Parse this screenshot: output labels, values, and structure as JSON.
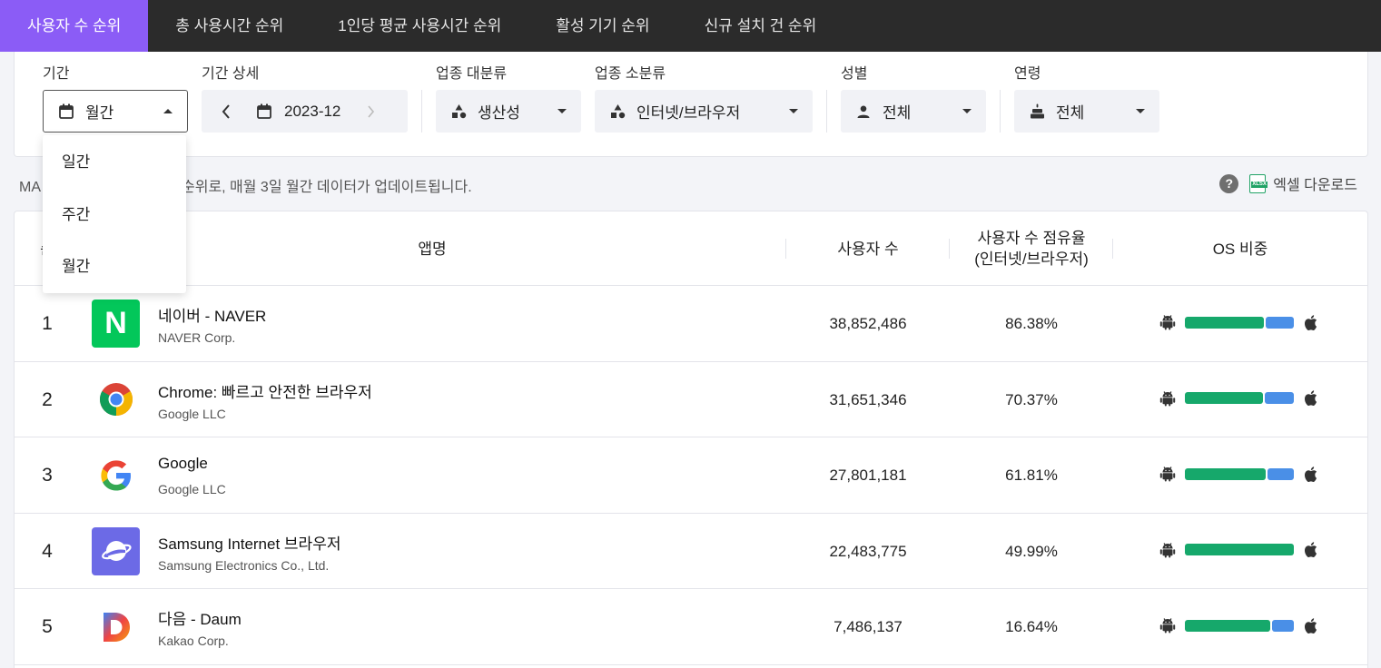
{
  "tabs": [
    "사용자 수 순위",
    "총 사용시간 순위",
    "1인당 평균 사용시간 순위",
    "활성 기기 순위",
    "신규 설치 건 순위"
  ],
  "filters": {
    "period_label": "기간",
    "period_value": "월간",
    "period_detail_label": "기간 상세",
    "period_detail_value": "2023-12",
    "major_category_label": "업종 대분류",
    "major_category_value": "생산성",
    "minor_category_label": "업종 소분류",
    "minor_category_value": "인터넷/브라우저",
    "gender_label": "성별",
    "gender_value": "전체",
    "age_label": "연령",
    "age_value": "전체"
  },
  "period_dropdown": [
    "일간",
    "주간",
    "월간"
  ],
  "info_prefix": "MA",
  "info_text": "ers) 순위로, 매월 3일 월간 데이터가 업데이트됩니다.",
  "excel_download": "엑셀 다운로드",
  "excel_badge": "XLSX",
  "table": {
    "headers": {
      "rank": "순",
      "app": "앱명",
      "users": "사용자 수",
      "share_line1": "사용자 수 점유율",
      "share_line2": "(인터넷/브라우저)",
      "os": "OS 비중"
    },
    "rows": [
      {
        "rank": "1",
        "name": "네이버 - NAVER",
        "company": "NAVER Corp.",
        "users": "38,852,486",
        "share": "86.38%",
        "android_share": 0.74,
        "logo": "naver-logo",
        "logo_text": "N"
      },
      {
        "rank": "2",
        "name": "Chrome: 빠르고 안전한 브라우저",
        "company": "Google LLC",
        "users": "31,651,346",
        "share": "70.37%",
        "android_share": 0.73,
        "logo": "chrome-logo"
      },
      {
        "rank": "3",
        "name": "Google",
        "company": "Google LLC",
        "users": "27,801,181",
        "share": "61.81%",
        "android_share": 0.75,
        "logo": "google-logo"
      },
      {
        "rank": "4",
        "name": "Samsung Internet 브라우저",
        "company": "Samsung Electronics Co., Ltd.",
        "users": "22,483,775",
        "share": "49.99%",
        "android_share": 1.0,
        "logo": "samsung-internet-logo"
      },
      {
        "rank": "5",
        "name": "다음 - Daum",
        "company": "Kakao Corp.",
        "users": "7,486,137",
        "share": "16.64%",
        "android_share": 0.8,
        "logo": "daum-logo",
        "logo_text": "D"
      }
    ]
  },
  "colors": {
    "accent": "#8b5cf6",
    "android_bar": "#16a86b",
    "ios_bar": "#4a8fe7"
  }
}
